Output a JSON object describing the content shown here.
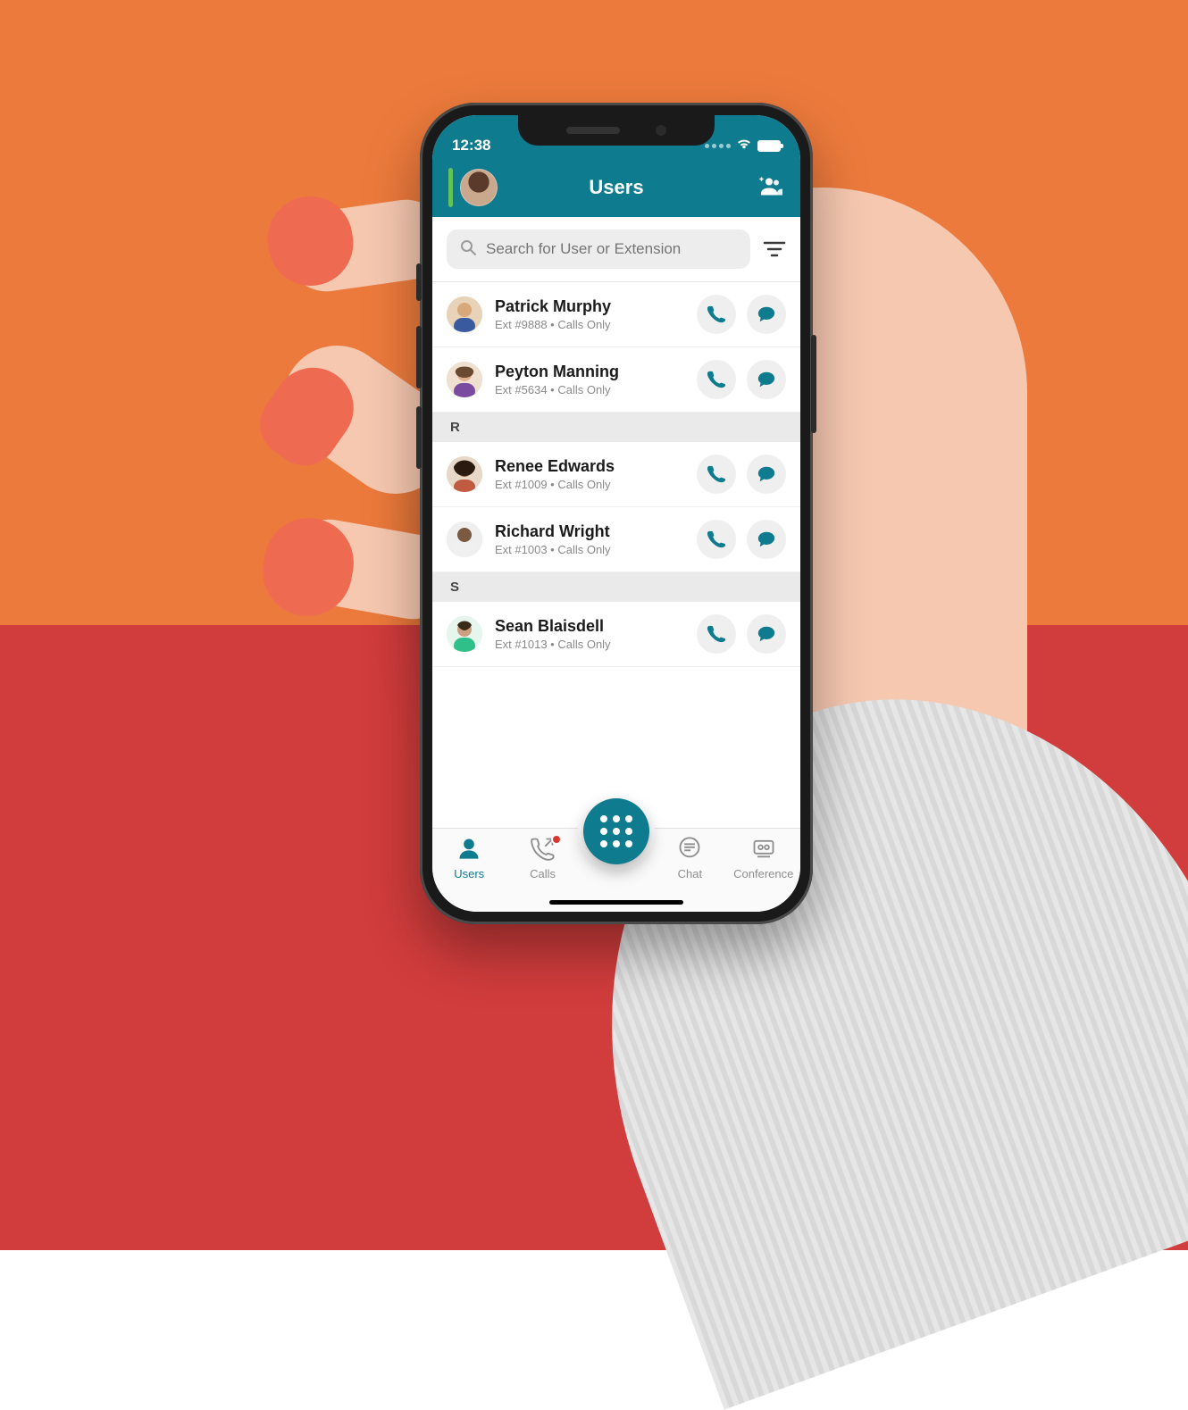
{
  "colors": {
    "brand": "#0f7b8f",
    "bgTop": "#ec7a3c",
    "bgBottom": "#d13c3c",
    "nail": "#ee6b52",
    "badge": "#d9372f"
  },
  "status": {
    "time": "12:38"
  },
  "header": {
    "title": "Users",
    "add_group_icon": "add-group-icon"
  },
  "search": {
    "placeholder": "Search for User or Extension"
  },
  "sections": [
    {
      "letter": "",
      "users": [
        {
          "name": "Patrick Murphy",
          "meta": "Ext #9888  •  Calls Only"
        },
        {
          "name": "Peyton Manning",
          "meta": "Ext #5634  •  Calls Only"
        }
      ]
    },
    {
      "letter": "R",
      "users": [
        {
          "name": "Renee Edwards",
          "meta": "Ext #1009  •  Calls Only"
        },
        {
          "name": "Richard Wright",
          "meta": "Ext #1003  •  Calls Only"
        }
      ]
    },
    {
      "letter": "S",
      "users": [
        {
          "name": "Sean Blaisdell",
          "meta": "Ext #1013  •  Calls Only"
        }
      ]
    }
  ],
  "tabs": {
    "users": "Users",
    "calls": "Calls",
    "chat": "Chat",
    "conference": "Conference"
  }
}
